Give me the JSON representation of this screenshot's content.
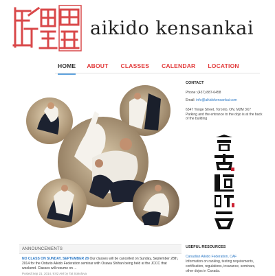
{
  "header": {
    "site_title": "aikido kensankai",
    "logo_alt": "kensankai-logo"
  },
  "nav": {
    "items": [
      {
        "label": "HOME",
        "active": true
      },
      {
        "label": "ABOUT",
        "active": false
      },
      {
        "label": "CLASSES",
        "active": false
      },
      {
        "label": "CALENDAR",
        "active": false
      },
      {
        "label": "LOCATION",
        "active": false
      }
    ]
  },
  "contact": {
    "heading": "CONTACT",
    "phone": "Phone: (437) 887-6458",
    "email_label": "Email: ",
    "email": "info@aikidokensankai.com",
    "address": "6347 Yonge Street, Toronto, ON, M2M 3X7",
    "parking": "Parking and the entrance to the dojo is at the back of the building"
  },
  "announcements": {
    "heading": "ANNOUNCEMENTS",
    "items": [
      {
        "title": "NO CLASS ON SUNDAY, SEPTEMBER 28",
        "text": " Our classes will be cancelled on Sunday, September 28th, 2014 for the Ontario Aikido Federation seminar with Osawa Shihan being held at the JCCC that weekend. Classes will resume on ...",
        "meta": "Posted Sep 21, 2014, 9:02 AM by Tat Sokolova"
      }
    ]
  },
  "resources": {
    "heading": "USEFUL RESOURCES",
    "link": "Canadian Aikido Federation, CAF",
    "text": "Information on ranking, testing requirements, certification, regulations, insurance, seminars, other dojos in Canada."
  },
  "colors": {
    "accent_red": "#e23b3b",
    "link_blue": "#2b78c5",
    "active_underline": "#5fa3df"
  }
}
